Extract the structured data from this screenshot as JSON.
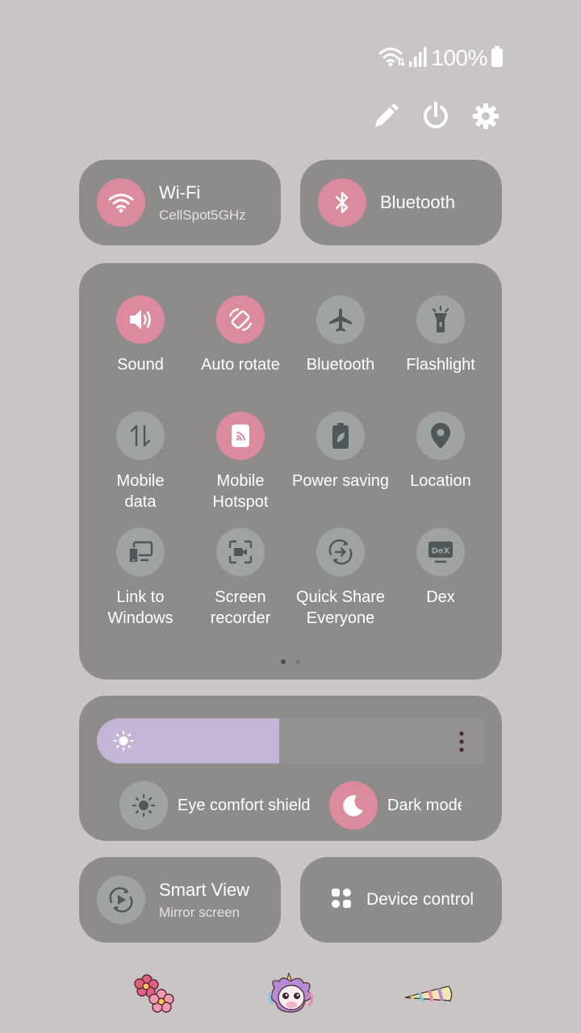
{
  "status_bar": {
    "battery_percent": "100%",
    "icons": [
      "wifi-icon",
      "signal-icon",
      "battery-icon"
    ]
  },
  "top_actions": [
    "edit-icon",
    "power-icon",
    "settings-icon"
  ],
  "wifi": {
    "label": "Wi-Fi",
    "network": "CellSpot5GHz",
    "state": "on"
  },
  "bluetooth": {
    "label": "Bluetooth",
    "state": "on"
  },
  "quick_tiles": [
    {
      "label": "Sound",
      "icon": "sound-icon",
      "state": "on"
    },
    {
      "label": "Auto rotate",
      "icon": "auto-rotate-icon",
      "state": "on"
    },
    {
      "label": "Bluetooth",
      "icon": "airplane-icon",
      "state": "off"
    },
    {
      "label": "Flashlight",
      "icon": "flashlight-icon",
      "state": "off"
    },
    {
      "label": "Mobile\ndata",
      "icon": "mobile-data-icon",
      "state": "off"
    },
    {
      "label": "Mobile\nHotspot",
      "icon": "hotspot-icon",
      "state": "on"
    },
    {
      "label": "Power saving",
      "icon": "power-saving-icon",
      "state": "off"
    },
    {
      "label": "Location",
      "icon": "location-icon",
      "state": "off"
    },
    {
      "label": "Link to\nWindows",
      "icon": "link-to-windows-icon",
      "state": "off"
    },
    {
      "label": "Screen\nrecorder",
      "icon": "screen-recorder-icon",
      "state": "off"
    },
    {
      "label": "Quick Share\nEveryone",
      "icon": "quick-share-icon",
      "state": "off"
    },
    {
      "label": "Dex",
      "icon": "dex-icon",
      "state": "off"
    }
  ],
  "pager": {
    "pages": 2,
    "current": 1
  },
  "brightness": {
    "level": 0.47,
    "eye_comfort_label": "Eye comfort shield",
    "dark_mode_label": "Dark mode"
  },
  "smart_view": {
    "label": "Smart View",
    "subtitle": "Mirror screen"
  },
  "device_control": {
    "label": "Device control"
  },
  "stickers": [
    "flower-sticker",
    "unicorn-sticker",
    "unicorn-horn-sticker"
  ],
  "colors": {
    "background": "#c8c5c4",
    "card": "#8e8c8b",
    "active": "#dc8a9e",
    "inactive": "#9fa4a3",
    "icon_inactive": "#4e5858",
    "brightness_fill": "#c4b4d6"
  }
}
